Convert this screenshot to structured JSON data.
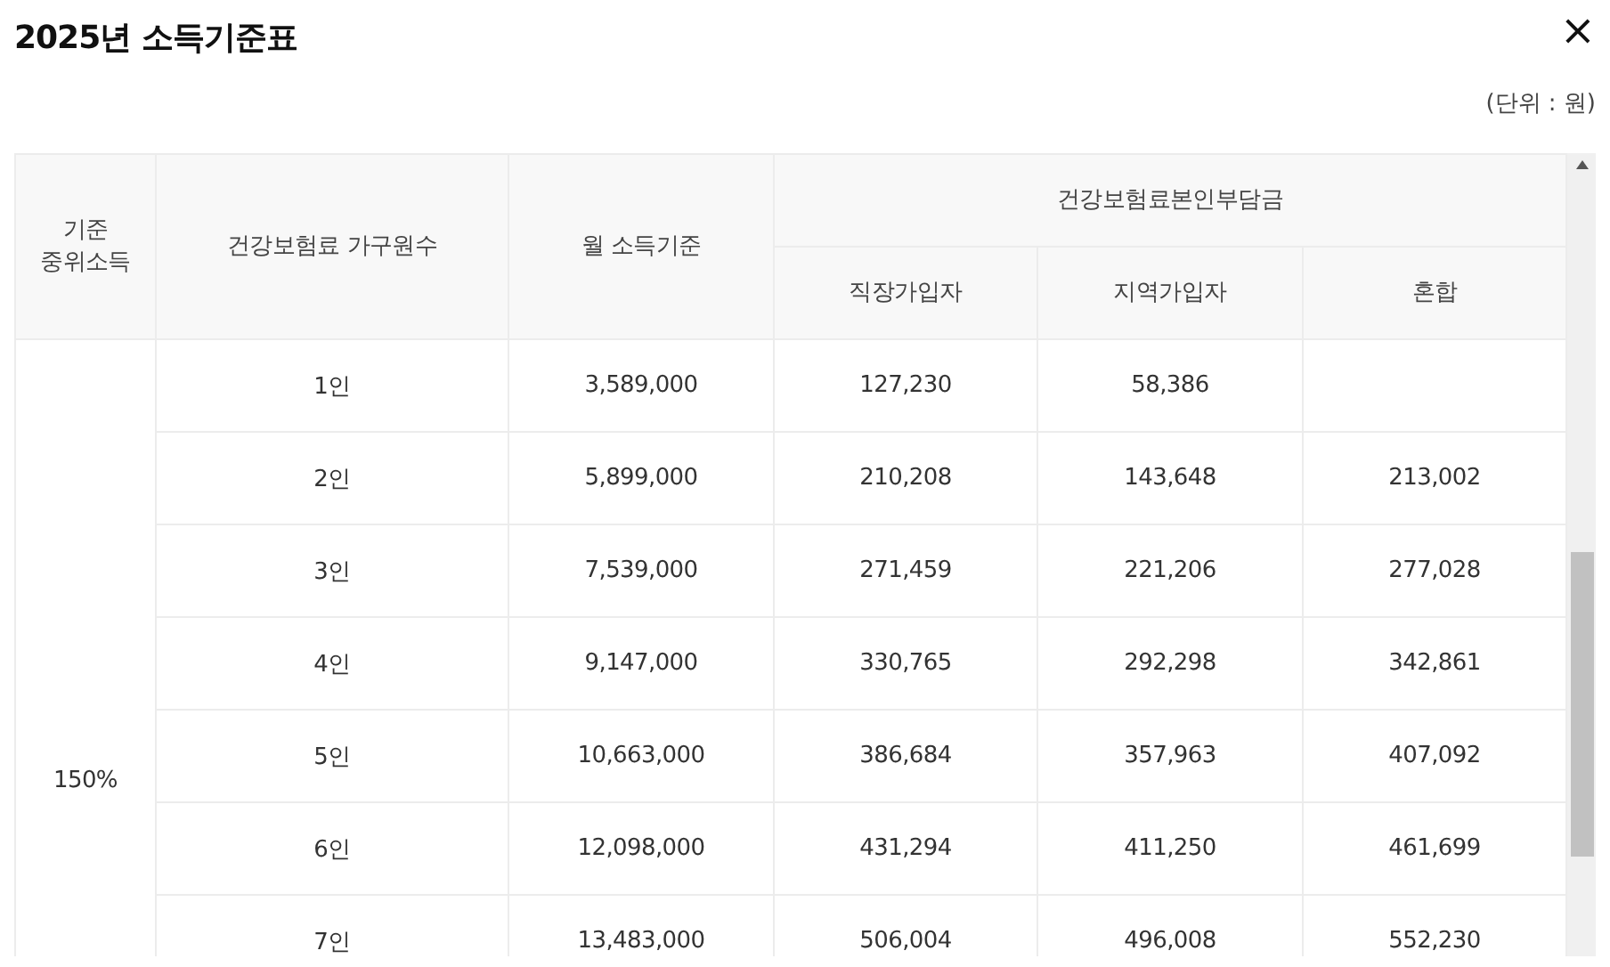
{
  "dialog": {
    "title": "2025년 소득기준표",
    "close_icon": "×",
    "unit_note": "(단위 : 원)"
  },
  "table": {
    "columns": {
      "median_income": "기준\n중위소득",
      "household_size": "건강보험료 가구원수",
      "monthly_income": "월 소득기준",
      "premium_group": "건강보험료본인부담금",
      "employee": "직장가입자",
      "regional": "지역가입자",
      "mixed": "혼합"
    },
    "group_label": "150%",
    "rows": [
      {
        "household_size": "1인",
        "monthly_income": "3,589,000",
        "employee": "127,230",
        "regional": "58,386"
      },
      {
        "household_size": "2인",
        "monthly_income": "5,899,000",
        "employee": "210,208",
        "regional": "143,648",
        "mixed": "213,002"
      },
      {
        "household_size": "3인",
        "monthly_income": "7,539,000",
        "employee": "271,459",
        "regional": "221,206",
        "mixed": "277,028"
      },
      {
        "household_size": "4인",
        "monthly_income": "9,147,000",
        "employee": "330,765",
        "regional": "292,298",
        "mixed": "342,861"
      },
      {
        "household_size": "5인",
        "monthly_income": "10,663,000",
        "employee": "386,684",
        "regional": "357,963",
        "mixed": "407,092"
      },
      {
        "household_size": "6인",
        "monthly_income": "12,098,000",
        "employee": "431,294",
        "regional": "411,250",
        "mixed": "461,699"
      },
      {
        "household_size": "7인",
        "monthly_income": "13,483,000",
        "employee": "506,004",
        "regional": "496,008",
        "mixed": "552,230"
      }
    ]
  }
}
